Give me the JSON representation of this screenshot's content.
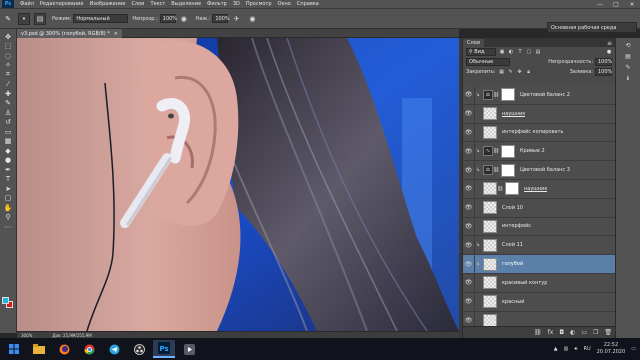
{
  "app": {
    "logo": "Ps",
    "menu": [
      "Файл",
      "Редактирование",
      "Изображение",
      "Слои",
      "Текст",
      "Выделение",
      "Фильтр",
      "3D",
      "Просмотр",
      "Окно",
      "Справка"
    ],
    "window_controls": [
      "—",
      "□",
      "✕"
    ]
  },
  "options": {
    "mode_label": "Режим:",
    "mode_value": "Нормальный",
    "opacity_label": "Непрозр.:",
    "opacity_value": "100%",
    "pressure_label": "Наж.:",
    "pressure_value": "100%",
    "workspace": "Основная рабочая среда"
  },
  "document": {
    "tab_title": "v3.psd @ 300% (голубой, RGB/8) *",
    "zoom": "300%",
    "doc_info": "Док: 25,9M/255,9M"
  },
  "colors": {
    "foreground": "#18b7e6",
    "background": "#d81d1d",
    "accent": "#5a7fa8"
  },
  "layers_panel": {
    "tab": "Слои",
    "filter_kind": "Вид",
    "blend_mode": "Обычные",
    "opacity_label": "Непрозрачность:",
    "opacity_value": "100%",
    "lock_label": "Закрепить:",
    "fill_label": "Заливка:",
    "fill_value": "100%",
    "layers": [
      {
        "name": "Цветовой баланс 2",
        "kind": "adjustment",
        "adj_icon": "balance-icon",
        "clipped": true,
        "mask": true
      },
      {
        "name": "наушник",
        "kind": "pixel",
        "clipped": false,
        "link": true
      },
      {
        "name": "интерфейс копировать",
        "kind": "pixel",
        "clipped": false
      },
      {
        "name": "Кривые 2",
        "kind": "adjustment",
        "adj_icon": "curves-icon",
        "clipped": true,
        "mask": true
      },
      {
        "name": "Цветовой баланс 3",
        "kind": "adjustment",
        "adj_icon": "balance-icon",
        "clipped": true,
        "mask": true
      },
      {
        "name": "наушник",
        "kind": "masked",
        "clipped": false,
        "mask": true,
        "link": true
      },
      {
        "name": "Слой 10",
        "kind": "pixel",
        "clipped": false
      },
      {
        "name": "интерфейс",
        "kind": "pixel",
        "clipped": false
      },
      {
        "name": "Слой 11",
        "kind": "pixel",
        "clipped": true
      },
      {
        "name": "голубой",
        "kind": "pixel",
        "clipped": true,
        "selected": true
      },
      {
        "name": "красивый контур",
        "kind": "pixel",
        "clipped": false
      },
      {
        "name": "красный",
        "kind": "pixel",
        "clipped": false
      },
      {
        "name": "",
        "kind": "pixel",
        "clipped": false
      }
    ]
  },
  "taskbar": {
    "apps": [
      "start-icon",
      "explorer-icon",
      "firefox-icon",
      "chrome-icon",
      "telegram-icon",
      "obs-icon",
      "photoshop-icon",
      "media-icon"
    ],
    "language": "RU",
    "time": "22:52",
    "date": "20.07.2020"
  }
}
